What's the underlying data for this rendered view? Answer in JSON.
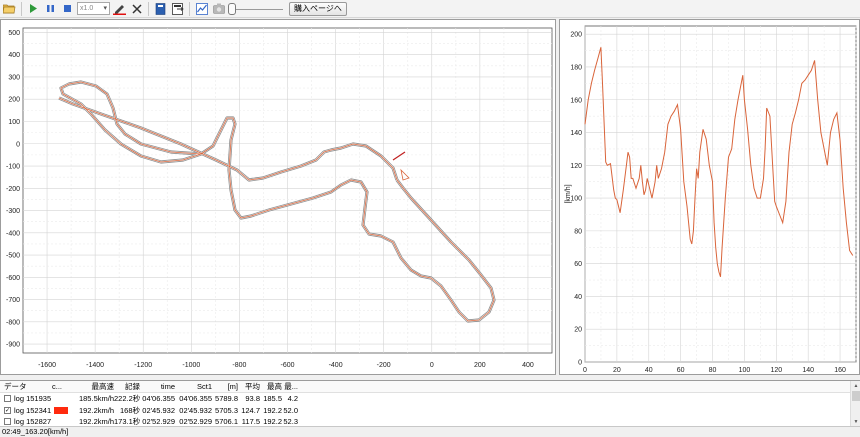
{
  "toolbar": {
    "speed": "x1.0",
    "buy_label": "購入ページへ"
  },
  "map": {
    "x_ticks": [
      "-1600",
      "-1400",
      "-1200",
      "-1000",
      "-800",
      "-600",
      "-400",
      "-200",
      "0",
      "200",
      "400"
    ],
    "y_ticks": [
      "500",
      "400",
      "300",
      "200",
      "100",
      "0",
      "-100",
      "-200",
      "-300",
      "-400",
      "-500",
      "-600",
      "-700",
      "-800",
      "-900"
    ]
  },
  "chart_data": {
    "type": "line",
    "title": "",
    "xlabel": "",
    "ylabel": "[km/h]",
    "xlim": [
      0,
      170
    ],
    "ylim": [
      0,
      205
    ],
    "x_ticks": [
      "0",
      "20",
      "40",
      "60",
      "80",
      "100",
      "120",
      "140",
      "160"
    ],
    "y_ticks": [
      "200",
      "180",
      "160",
      "140",
      "120",
      "100",
      "80",
      "60",
      "40",
      "20",
      "0"
    ],
    "series": [
      {
        "color": "#d9643a",
        "x": [
          0,
          2,
          4,
          6,
          8,
          10,
          11,
          13,
          14,
          16,
          18,
          19,
          20,
          22,
          24,
          26,
          27,
          28,
          29,
          30,
          32,
          34,
          35,
          36,
          37,
          38,
          39,
          40,
          42,
          44,
          45,
          46,
          48,
          50,
          52,
          54,
          56,
          58,
          60,
          62,
          64,
          65,
          66,
          67,
          68,
          69,
          70,
          71,
          72,
          74,
          76,
          78,
          80,
          81,
          82,
          83,
          84,
          85,
          86,
          88,
          90,
          92,
          94,
          96,
          97,
          98,
          99,
          100,
          102,
          104,
          106,
          108,
          110,
          112,
          113,
          114,
          116,
          118,
          119,
          120,
          122,
          124,
          126,
          128,
          130,
          132,
          134,
          136,
          138,
          140,
          142,
          144,
          146,
          148,
          150,
          152,
          154,
          156,
          158,
          160,
          162,
          164,
          166,
          168
        ],
        "y": [
          145,
          160,
          170,
          178,
          185,
          192,
          170,
          122,
          120,
          121,
          105,
          100,
          99,
          91,
          105,
          120,
          128,
          125,
          112,
          112,
          106,
          112,
          120,
          110,
          102,
          105,
          112,
          108,
          100,
          110,
          120,
          112,
          118,
          128,
          145,
          150,
          153,
          157,
          142,
          110,
          95,
          85,
          75,
          72,
          80,
          100,
          118,
          112,
          128,
          142,
          136,
          120,
          110,
          85,
          70,
          60,
          55,
          52,
          70,
          100,
          125,
          130,
          148,
          160,
          165,
          170,
          175,
          160,
          142,
          120,
          106,
          100,
          100,
          112,
          130,
          155,
          150,
          115,
          98,
          95,
          90,
          85,
          98,
          128,
          145,
          152,
          160,
          170,
          172,
          175,
          178,
          184,
          160,
          140,
          130,
          120,
          140,
          148,
          152,
          135,
          106,
          85,
          68,
          65
        ]
      }
    ]
  },
  "table": {
    "headers": [
      "データ",
      "c...",
      "最高速",
      "記録",
      "time",
      "Sct1",
      "[m]",
      "平均",
      "最高",
      "最..."
    ],
    "rows": [
      {
        "checked": false,
        "name": "log 151935",
        "color": "",
        "max": "185.5km/h",
        "rec": "222.2秒",
        "time": "04'06.355",
        "sct1": "04'06.355",
        "m": "5789.8",
        "avg": "93.8",
        "hi": "185.5",
        "lo": "4.2"
      },
      {
        "checked": true,
        "name": "log 152341",
        "color": "#ff2a0e",
        "max": "192.2km/h",
        "rec": "168秒",
        "time": "02'45.932",
        "sct1": "02'45.932",
        "m": "5705.3",
        "avg": "124.7",
        "hi": "192.2",
        "lo": "52.0"
      },
      {
        "checked": false,
        "name": "log 152827",
        "color": "",
        "max": "192.2km/h",
        "rec": "173.1秒",
        "time": "02'52.929",
        "sct1": "02'52.929",
        "m": "5706.1",
        "avg": "117.5",
        "hi": "192.2",
        "lo": "52.3"
      }
    ]
  },
  "status": {
    "text": "02:49_163.20[km/h]"
  }
}
